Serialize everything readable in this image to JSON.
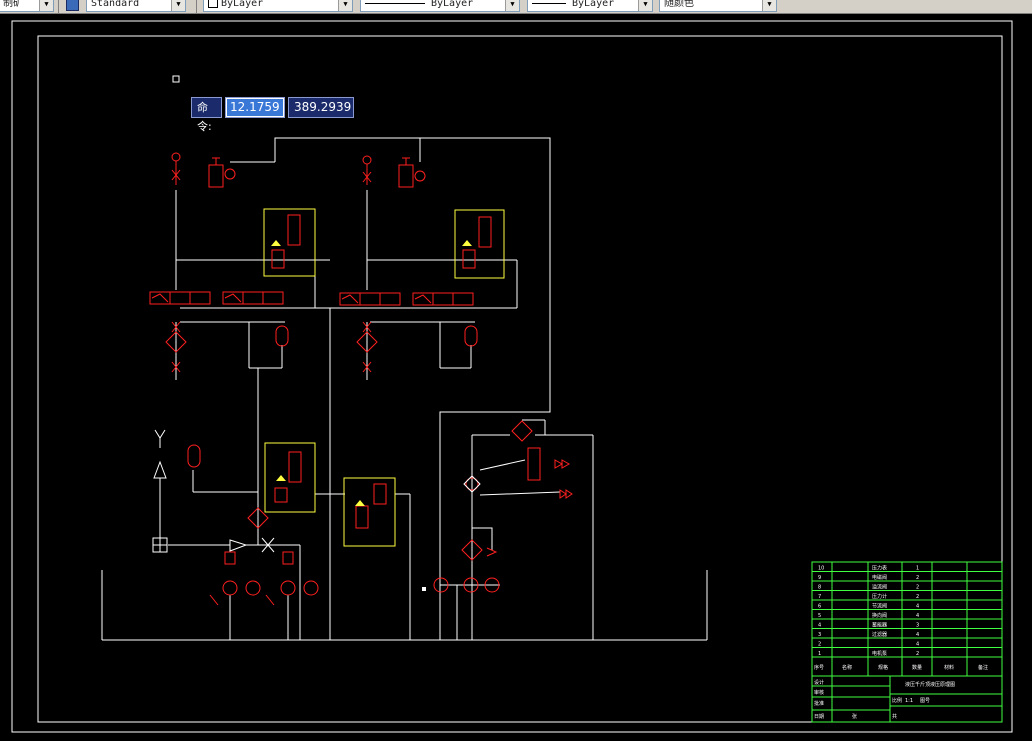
{
  "toolbar": {
    "combo_style_left": "制矿",
    "text_style": "Standard",
    "layer": "ByLayer",
    "linetype": "ByLayer",
    "lineweight": "ByLayer",
    "color": "随颜色"
  },
  "command": {
    "label": "命令:",
    "x_value": "12.1759",
    "y_value": "389.2939"
  },
  "title_block": {
    "rows": [
      {
        "no": "10",
        "name": "压力表",
        "qty": "1"
      },
      {
        "no": "9",
        "name": "电磁阀",
        "qty": "2"
      },
      {
        "no": "8",
        "name": "溢流阀",
        "qty": "2"
      },
      {
        "no": "7",
        "name": "压力计",
        "qty": "2"
      },
      {
        "no": "6",
        "name": "节流阀",
        "qty": "4"
      },
      {
        "no": "5",
        "name": "换向阀",
        "qty": "4"
      },
      {
        "no": "4",
        "name": "蓄能器",
        "qty": "3"
      },
      {
        "no": "3",
        "name": "过滤器",
        "qty": "4"
      },
      {
        "no": "2",
        "name": "",
        "qty": "4"
      },
      {
        "no": "1",
        "name": "电机泵",
        "qty": "2"
      }
    ],
    "headers": [
      "序号",
      "名称",
      "规格",
      "数量",
      "材料",
      "备注"
    ],
    "drawing_title": "液压千斤顶液压原理图",
    "labels": [
      "设计",
      "审核",
      "批准",
      "日期",
      "比例",
      "1:1",
      "图号",
      "共",
      "张"
    ]
  },
  "colors": {
    "frame": "#ffffff",
    "pipe": "#ffffff",
    "component": "#ff2020",
    "valve_box": "#ffff40",
    "table": "#40ff40"
  }
}
